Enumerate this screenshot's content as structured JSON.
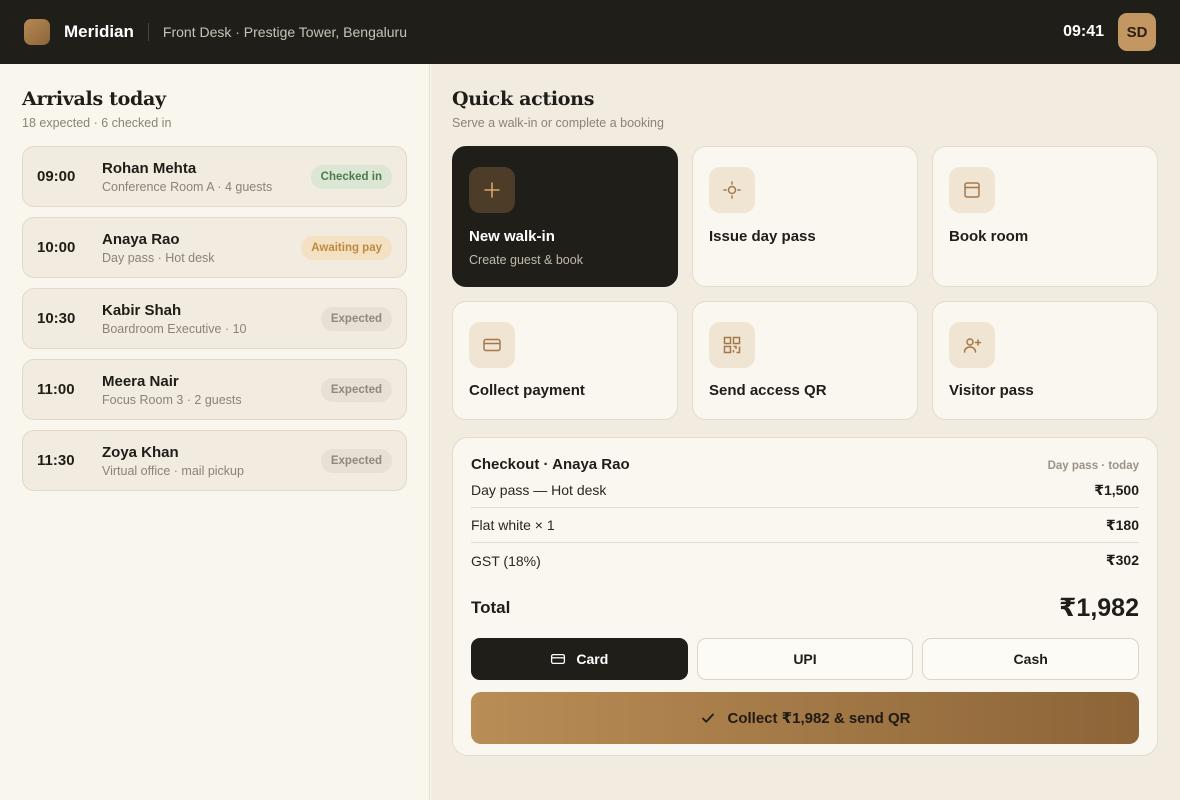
{
  "header": {
    "brand": "Meridian",
    "location": "Front Desk · Prestige Tower, Bengaluru",
    "time": "09:41",
    "user_initials": "SD"
  },
  "arrivals": {
    "title": "Arrivals today",
    "subtitle": "18 expected · 6 checked in",
    "items": [
      {
        "time": "09:00",
        "name": "Rohan Mehta",
        "detail": "Conference Room A · 4 guests",
        "status": "Checked in"
      },
      {
        "time": "10:00",
        "name": "Anaya Rao",
        "detail": "Day pass · Hot desk",
        "status": "Awaiting pay"
      },
      {
        "time": "10:30",
        "name": "Kabir Shah",
        "detail": "Boardroom Executive · 10",
        "status": "Expected"
      },
      {
        "time": "11:00",
        "name": "Meera Nair",
        "detail": "Focus Room 3 · 2 guests",
        "status": "Expected"
      },
      {
        "time": "11:30",
        "name": "Zoya Khan",
        "detail": "Virtual office · mail pickup",
        "status": "Expected"
      }
    ]
  },
  "quick_actions": {
    "title": "Quick actions",
    "subtitle": "Serve a walk-in or complete a booking",
    "items": [
      {
        "label": "New walk-in",
        "desc": "Create guest & book",
        "icon": "plus-icon"
      },
      {
        "label": "Issue day pass",
        "icon": "sun-icon"
      },
      {
        "label": "Book room",
        "icon": "calendar-icon"
      },
      {
        "label": "Collect payment",
        "icon": "card-icon"
      },
      {
        "label": "Send access QR",
        "icon": "qr-icon"
      },
      {
        "label": "Visitor pass",
        "icon": "add-user-icon"
      }
    ]
  },
  "checkout": {
    "title": "Checkout · Anaya Rao",
    "meta": "Day pass · today",
    "lines": [
      {
        "label": "Day pass — Hot desk",
        "amount": "₹1,500"
      },
      {
        "label": "Flat white × 1",
        "amount": "₹180"
      },
      {
        "label": "GST (18%)",
        "amount": "₹302"
      }
    ],
    "total_label": "Total",
    "total_amount": "₹1,982",
    "methods": [
      "Card",
      "UPI",
      "Cash"
    ],
    "selected_method": "Card",
    "collect_label": "Collect ₹1,982 & send QR"
  },
  "colors": {
    "dark": "#201e19",
    "accent": "#b98d56",
    "checked_in": "#4d7a4c",
    "awaiting": "#c08a3e"
  }
}
